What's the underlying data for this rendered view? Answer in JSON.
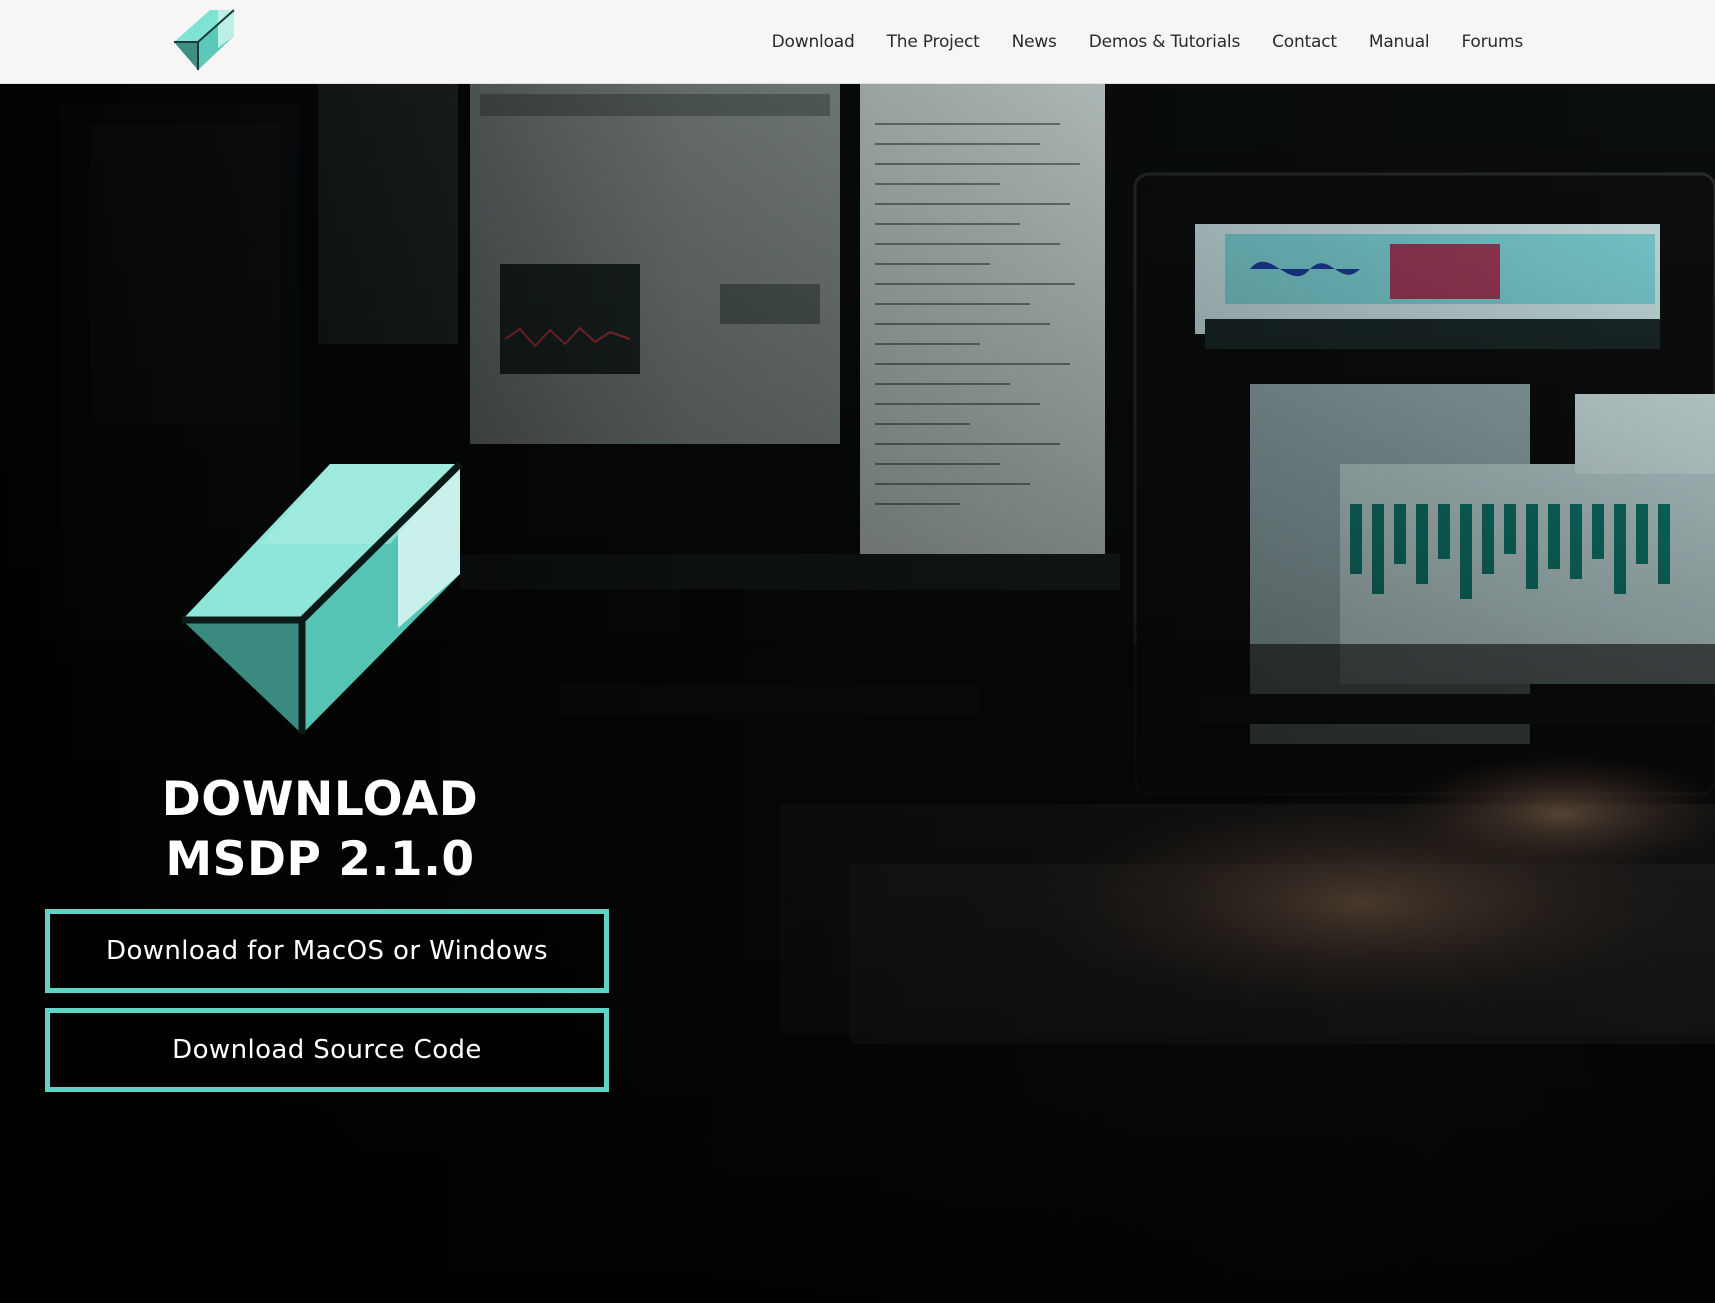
{
  "header": {
    "logo_icon": "cube-logo-icon",
    "nav": [
      {
        "label": "Download"
      },
      {
        "label": "The Project"
      },
      {
        "label": "News"
      },
      {
        "label": "Demos & Tutorials"
      },
      {
        "label": "Contact"
      },
      {
        "label": "Manual"
      },
      {
        "label": "Forums"
      }
    ]
  },
  "hero": {
    "logo_icon": "cube-logo-icon",
    "title_line1": "DOWNLOAD",
    "title_line2": "MSDP 2.1.0",
    "buttons": [
      {
        "label": "Download for MacOS or Windows"
      },
      {
        "label": "Download Source Code"
      }
    ],
    "background_image": "photo of a music studio desk with monitors running MSDP and a hand on a keyboard"
  },
  "colors": {
    "accent": "#5fd3c6",
    "header_bg": "#f6f6f6",
    "nav_text": "#2b2b2b",
    "hero_bg": "#060707",
    "title_text": "#ffffff"
  }
}
